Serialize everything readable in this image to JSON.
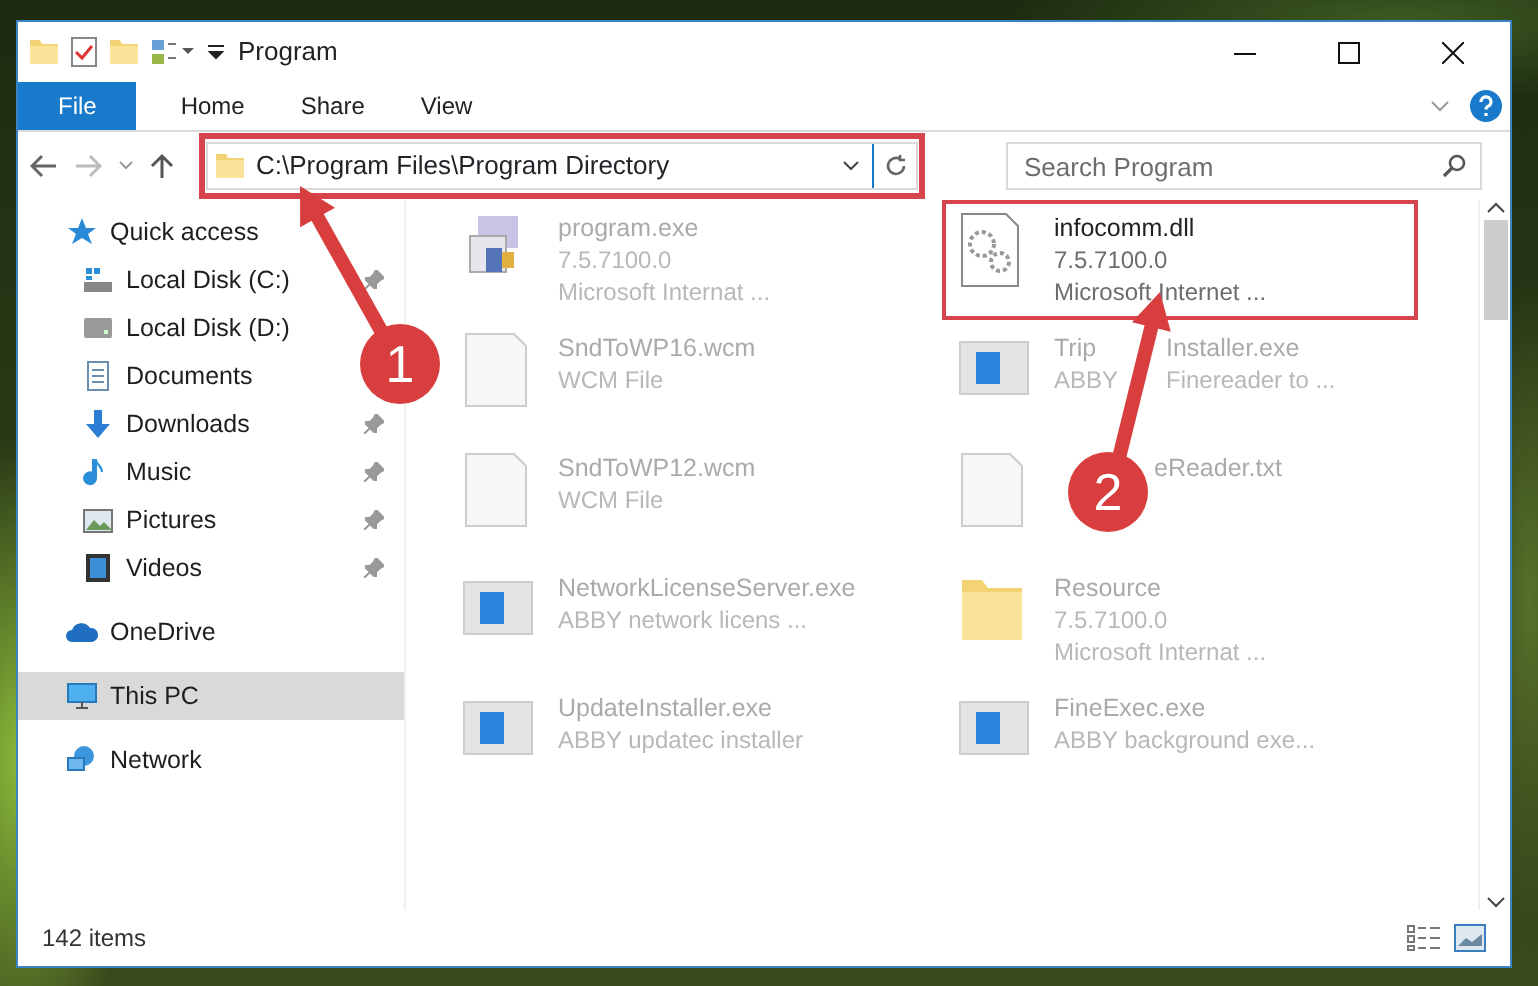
{
  "window": {
    "title": "Program"
  },
  "ribbon_tabs": [
    {
      "label": "File",
      "selected": true
    },
    {
      "label": "Home",
      "selected": false
    },
    {
      "label": "Share",
      "selected": false
    },
    {
      "label": "View",
      "selected": false
    }
  ],
  "address": {
    "path": "C:\\Program Files\\Program Directory"
  },
  "search": {
    "placeholder": "Search Program"
  },
  "sidebar": {
    "items": [
      {
        "label": "Quick access",
        "kind": "star",
        "selected": false,
        "children": [
          {
            "label": "Local Disk (C:)",
            "kind": "diskc",
            "selected": false,
            "pinned": true
          },
          {
            "label": "Local Disk (D:)",
            "kind": "disk",
            "selected": false,
            "pinned": false
          },
          {
            "label": "Documents",
            "kind": "docs",
            "selected": false,
            "pinned": false
          },
          {
            "label": "Downloads",
            "kind": "down",
            "selected": false,
            "pinned": true
          },
          {
            "label": "Music",
            "kind": "music",
            "selected": false,
            "pinned": true
          },
          {
            "label": "Pictures",
            "kind": "pics",
            "selected": false,
            "pinned": true
          },
          {
            "label": "Videos",
            "kind": "video",
            "selected": false,
            "pinned": true
          }
        ]
      },
      {
        "label": "OneDrive",
        "kind": "cloud",
        "selected": false
      },
      {
        "label": "This PC",
        "kind": "pc",
        "selected": true
      },
      {
        "label": "Network",
        "kind": "net",
        "selected": false
      }
    ]
  },
  "files": [
    {
      "name": "program.exe",
      "details": [
        "7.5.7100.0",
        "Microsoft Internat ..."
      ],
      "kind": "app",
      "highlighted": false
    },
    {
      "name": "infocomm.dll",
      "details": [
        "7.5.7100.0",
        "Microsoft Internet ..."
      ],
      "kind": "dll",
      "highlighted": true
    },
    {
      "name": "SndToWP16.wcm",
      "details": [
        "WCM File"
      ],
      "kind": "blank",
      "highlighted": false
    },
    {
      "name": [
        "Trip",
        "Installer.exe"
      ],
      "details": [
        [
          "ABBY",
          "Finereader to ..."
        ]
      ],
      "kind": "window",
      "highlighted": false
    },
    {
      "name": "SndToWP12.wcm",
      "details": [
        "WCM File"
      ],
      "kind": "blank",
      "highlighted": false
    },
    {
      "name": "eReader.txt",
      "kind": "blank",
      "highlighted": false
    },
    {
      "name": "NetworkLicenseServer.exe",
      "details": [
        "ABBY network licens ..."
      ],
      "kind": "window",
      "highlighted": false
    },
    {
      "name": "Resource",
      "details": [
        "7.5.7100.0",
        "Microsoft Internat ..."
      ],
      "kind": "folder",
      "highlighted": false
    },
    {
      "name": "UpdateInstaller.exe",
      "details": [
        "ABBY updatec installer"
      ],
      "kind": "window",
      "highlighted": false
    },
    {
      "name": "FineExec.exe",
      "details": [
        "ABBY background exe..."
      ],
      "kind": "window",
      "highlighted": false
    }
  ],
  "status_bar": {
    "count": "142 items"
  },
  "annotations": [
    {
      "number": "1"
    },
    {
      "number": "2"
    }
  ]
}
